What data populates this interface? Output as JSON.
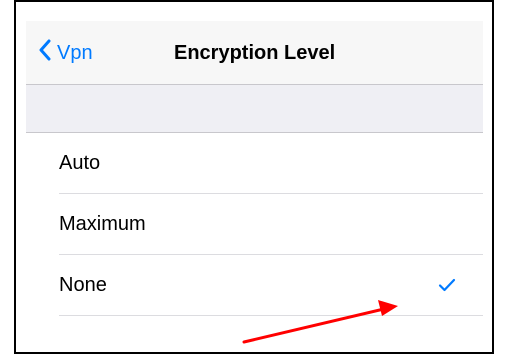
{
  "navbar": {
    "back_label": "Vpn",
    "title": "Encryption Level"
  },
  "options": [
    {
      "label": "Auto",
      "selected": false
    },
    {
      "label": "Maximum",
      "selected": false
    },
    {
      "label": "None",
      "selected": true
    }
  ],
  "colors": {
    "accent": "#007aff",
    "annotation_arrow": "#ff0000"
  },
  "icons": {
    "back": "chevron-left-icon",
    "selected": "checkmark-icon"
  }
}
